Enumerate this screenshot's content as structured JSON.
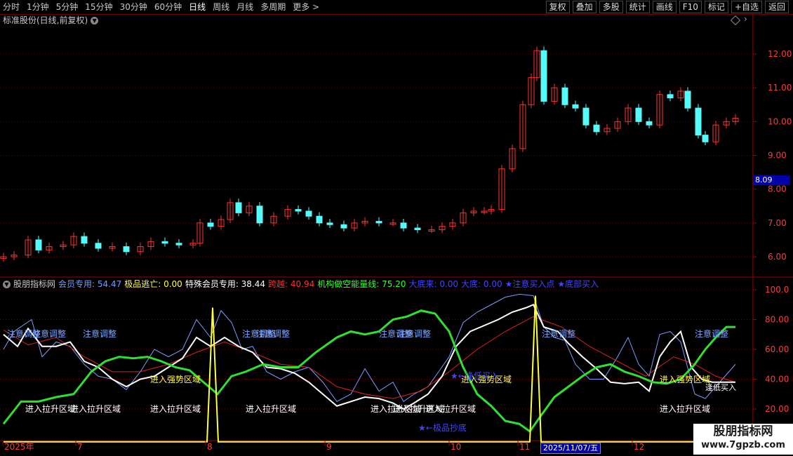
{
  "toolbar": {
    "periods": [
      "分时",
      "1分钟",
      "5分钟",
      "15分钟",
      "30分钟",
      "60分钟",
      "日线",
      "周线",
      "月线",
      "多周期",
      "更多 >"
    ],
    "active_period": "日线",
    "buttons": [
      "复权",
      "叠加",
      "多股",
      "统计",
      "画线",
      "F10",
      "标记",
      "+自选",
      "返回"
    ]
  },
  "main_chart": {
    "title": "标准股份(日线,前复权)",
    "y_ticks": [
      "12.00",
      "11.00",
      "10.00",
      "9.00",
      "8.00",
      "7.00",
      "6.00"
    ],
    "current_price": "8.09",
    "colors": {
      "up": "#ff3232",
      "down": "#54fcfc",
      "grid": "#7a0000"
    }
  },
  "indicator": {
    "name": "股朋指标网",
    "values": [
      {
        "label": "会员专用: 54.47",
        "color": "#6f9cff"
      },
      {
        "label": "极品逃亡: 0.00",
        "color": "#ffff40"
      },
      {
        "label": "特殊会员专用: 38.44",
        "color": "#ffffff"
      },
      {
        "label": "跨越: 40.94",
        "color": "#ff3030"
      },
      {
        "label": "机构做空能量线: 75.20",
        "color": "#30ff30"
      },
      {
        "label": "大底来: 0.00",
        "color": "#4444ff"
      },
      {
        "label": "大底: 0.00",
        "color": "#4444ff"
      },
      {
        "label": "★注意买入点",
        "color": "#4444ff"
      },
      {
        "label": "★底部买入",
        "color": "#4444ff"
      }
    ],
    "y_ticks": [
      "100.0",
      "80.00",
      "60.00",
      "40.00",
      "20.00"
    ],
    "labels": {
      "adjust": "注意调整",
      "strong": "进入强势区域",
      "lift": "进入拉升区域",
      "bottom": "★←极品抄底",
      "bottom2": "★←极品抄底",
      "fish": "★←逢低买入",
      "fish2": "★←逢低买入",
      "low": "逢低买入"
    }
  },
  "x_axis": {
    "labels": [
      "2025年",
      "7",
      "8",
      "9",
      "10",
      "11",
      "12"
    ],
    "cursor_date": "2025/11/07/五"
  },
  "watermark": {
    "line1": "股朋指标网",
    "line2": "www.7gpzb.com"
  }
}
